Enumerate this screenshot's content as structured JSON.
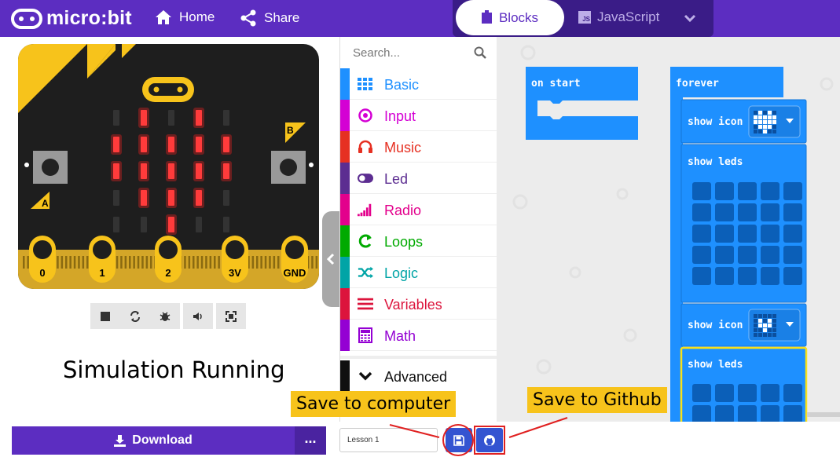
{
  "header": {
    "logo_text": "micro:bit",
    "nav": [
      {
        "label": "Home",
        "icon": "home-icon"
      },
      {
        "label": "Share",
        "icon": "share-icon"
      }
    ],
    "modes": {
      "blocks": "Blocks",
      "javascript": "JavaScript",
      "js_badge": "JS",
      "active": "Blocks"
    }
  },
  "simulator": {
    "button_a": "A",
    "button_b": "B",
    "pins": [
      "0",
      "1",
      "2",
      "3V",
      "GND"
    ],
    "led_matrix": [
      [
        0,
        1,
        0,
        1,
        0
      ],
      [
        1,
        1,
        1,
        1,
        1
      ],
      [
        1,
        1,
        1,
        1,
        1
      ],
      [
        0,
        1,
        1,
        1,
        0
      ],
      [
        0,
        0,
        1,
        0,
        0
      ]
    ],
    "controls": [
      "stop-icon",
      "restart-icon",
      "debug-icon",
      "sound-icon",
      "fullscreen-icon"
    ],
    "caption": "Simulation Running"
  },
  "toolbox": {
    "search_placeholder": "Search...",
    "categories": [
      {
        "label": "Basic",
        "color": "#1e90ff",
        "icon": "grid-icon"
      },
      {
        "label": "Input",
        "color": "#d400d4",
        "icon": "target-icon"
      },
      {
        "label": "Music",
        "color": "#e63022",
        "icon": "headphones-icon"
      },
      {
        "label": "Led",
        "color": "#5c2d91",
        "icon": "toggle-icon"
      },
      {
        "label": "Radio",
        "color": "#e3008c",
        "icon": "signal-icon"
      },
      {
        "label": "Loops",
        "color": "#00aa00",
        "icon": "loop-icon"
      },
      {
        "label": "Logic",
        "color": "#00a4a6",
        "icon": "shuffle-icon"
      },
      {
        "label": "Variables",
        "color": "#dc143c",
        "icon": "lines-icon"
      },
      {
        "label": "Math",
        "color": "#9400d3",
        "icon": "calculator-icon"
      }
    ],
    "advanced": {
      "label": "Advanced",
      "color": "#101010",
      "icon": "chevron-down-icon"
    }
  },
  "workspace": {
    "on_start": "on start",
    "forever": "forever",
    "show_icon": "show icon",
    "show_leds": "show leds",
    "block_color": "#1e90ff",
    "selected_outline": "#f7e11b"
  },
  "bottom_bar": {
    "download_label": "Download",
    "more_label": "...",
    "project_name": "Lesson 1"
  },
  "annotations": {
    "simulation_note": "Simulation Running",
    "save_computer": "Save to computer",
    "save_github": "Save to Github",
    "accent": "#f7c31b"
  }
}
